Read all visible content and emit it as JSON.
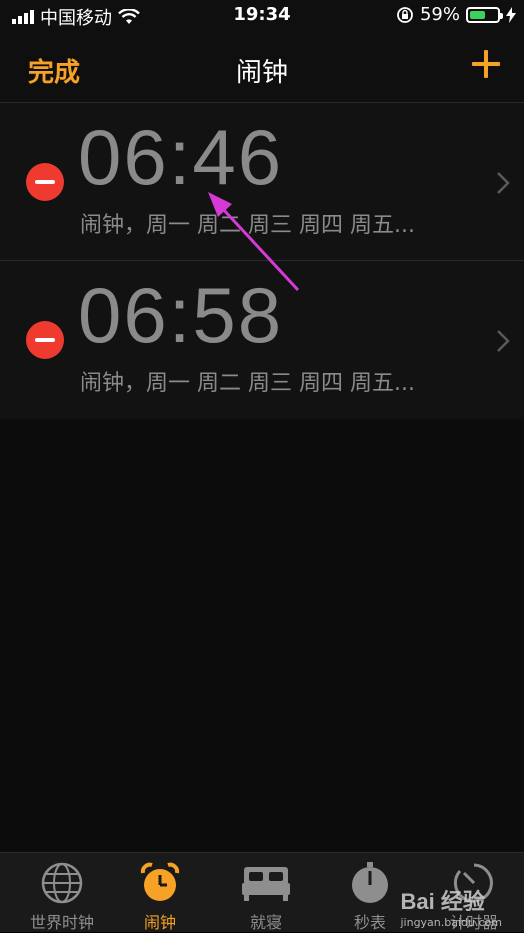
{
  "status_bar": {
    "carrier": "中国移动",
    "time": "19:34",
    "battery_percent": "59%",
    "battery_level": 0.59,
    "battery_color": "#3bd15a"
  },
  "nav": {
    "left_button": "完成",
    "title": "闹钟",
    "add_icon": "plus-icon",
    "accent_color": "#f7a127"
  },
  "alarms": [
    {
      "time": "06:46",
      "label": "闹钟，周一 周二 周三 周四 周五..."
    },
    {
      "time": "06:58",
      "label": "闹钟，周一 周二 周三 周四 周五..."
    }
  ],
  "tabs": [
    {
      "label": "世界时钟",
      "icon": "globe-icon",
      "active": false
    },
    {
      "label": "闹钟",
      "icon": "alarm-clock-icon",
      "active": true
    },
    {
      "label": "就寝",
      "icon": "bed-icon",
      "active": false
    },
    {
      "label": "秒表",
      "icon": "stopwatch-icon",
      "active": false
    },
    {
      "label": "计时器",
      "icon": "timer-icon",
      "active": false
    }
  ],
  "watermark": {
    "logo": "Bai 经验",
    "url": "jingyan.baidu.com"
  },
  "annotation_color": "#d63ad6"
}
